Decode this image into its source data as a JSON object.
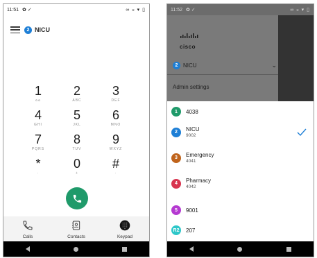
{
  "left": {
    "status_time": "11:51",
    "status_left_icons": "✿ ✓",
    "status_right_icons": "∞ ⁎ ▾ ▯",
    "line_badge": "2",
    "line_name": "NICU",
    "keypad": [
      [
        {
          "digit": "1",
          "letters": "ᴑᴑ"
        },
        {
          "digit": "2",
          "letters": "ABC"
        },
        {
          "digit": "3",
          "letters": "DEF"
        }
      ],
      [
        {
          "digit": "4",
          "letters": "GHI"
        },
        {
          "digit": "5",
          "letters": "JKL"
        },
        {
          "digit": "6",
          "letters": "MNO"
        }
      ],
      [
        {
          "digit": "7",
          "letters": "PQRS"
        },
        {
          "digit": "8",
          "letters": "TUV"
        },
        {
          "digit": "9",
          "letters": "WXYZ"
        }
      ],
      [
        {
          "digit": "*",
          "letters": "·"
        },
        {
          "digit": "0",
          "letters": "+"
        },
        {
          "digit": "#",
          "letters": "·"
        }
      ]
    ],
    "nav": {
      "calls": "Calls",
      "contacts": "Contacts",
      "keypad": "Keypad"
    },
    "colors": {
      "accent": "#1f9a6a",
      "badge": "#1e7fd6"
    }
  },
  "right": {
    "status_time": "11:52",
    "status_left_icons": "✿ ✓",
    "status_right_icons": "∞ ⁎ ▾ ▯",
    "brand": "cisco",
    "current_line_badge": "2",
    "current_line_name": "NICU",
    "admin_settings": "Admin settings",
    "lines": [
      {
        "badge": "1",
        "name": "4038",
        "number": "",
        "color": "#1f9a6a",
        "selected": false
      },
      {
        "badge": "2",
        "name": "NICU",
        "number": "9002",
        "color": "#1e7fd6",
        "selected": true
      },
      {
        "badge": "3",
        "name": "Emergency",
        "number": "4041",
        "color": "#c0641c",
        "selected": false
      },
      {
        "badge": "4",
        "name": "Pharmacy",
        "number": "4042",
        "color": "#d8344f",
        "selected": false
      },
      {
        "badge": "5",
        "name": "9001",
        "number": "",
        "color": "#b53ad1",
        "selected": false
      },
      {
        "badge": "R2",
        "name": "207",
        "number": "",
        "color": "#2ec7c9",
        "selected": false
      }
    ]
  }
}
